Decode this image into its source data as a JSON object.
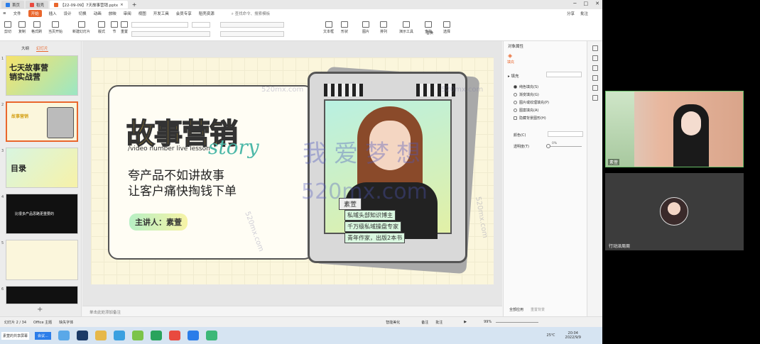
{
  "tabs": [
    {
      "label": "首页",
      "color": "#2b7de9"
    },
    {
      "label": "稻壳",
      "color": "#e94a3f"
    },
    {
      "label": "【22-09-09】7天故事营销.pptx",
      "color": "#e9662c"
    }
  ],
  "menu": {
    "file": "文件",
    "items": [
      "开始",
      "插入",
      "设计",
      "切换",
      "动画",
      "放映",
      "审阅",
      "视图",
      "开发工具",
      "会员专享",
      "稻壳资源"
    ],
    "search": "查找命令、搜索模板",
    "right": [
      "分享",
      "批注"
    ]
  },
  "ribbon": {
    "buttons": [
      "剪切",
      "复制",
      "格式刷",
      "当页开始",
      "新建幻灯片",
      "版式",
      "节",
      "重置",
      "文本框",
      "形状",
      "图片",
      "排列",
      "演示工具",
      "查找",
      "替换",
      "选择"
    ]
  },
  "thumbs": {
    "tabs": [
      "大纲",
      "幻灯片"
    ],
    "slides": [
      {
        "num": "1",
        "title": "七天故事营销实战营"
      },
      {
        "num": "2",
        "title": "故事营销"
      },
      {
        "num": "3",
        "title": "目录"
      },
      {
        "num": "4",
        "title": "比很多产品思路更重要的"
      },
      {
        "num": "5",
        "title": ""
      },
      {
        "num": "6",
        "title": ""
      }
    ],
    "add": "+"
  },
  "slide": {
    "hero": "故事营销",
    "story": "story",
    "sub": "/video number live lesson",
    "line1": "夸产品不如讲故事",
    "line2": "让客户痛快掏钱下单",
    "speaker": "主讲人：素萱",
    "name_tag": "素萱",
    "tags": [
      "私域头部知识博主",
      "千万级私域操盘专家",
      "青年作家，出版2本书"
    ]
  },
  "watermark": {
    "main": "我爱梦想",
    "domain": "520mx.com",
    "small": "520mx.com"
  },
  "notes": "单击此处添加备注",
  "status": {
    "slide": "幻灯片 2 / 34",
    "theme": "Office 主题",
    "font": "缺失字体",
    "beautify": "智能美化",
    "notes_btn": "备注",
    "comment_btn": "批注",
    "zoom": "99%"
  },
  "props": {
    "title": "对象属性",
    "tab": "填充",
    "section": "▸ 填充",
    "options": [
      "纯色填充(S)",
      "渐变填充(G)",
      "图片或纹理填充(P)",
      "图案填充(A)",
      "隐藏背景图形(H)"
    ],
    "selected_index": 0,
    "color_label": "颜色(C)",
    "transparency_label": "透明度(T)",
    "transparency_value": "0%",
    "apply_all": "全部应用",
    "reset": "重置背景"
  },
  "taskbar": {
    "items": [
      "素萱的共享屏幕",
      "会议..."
    ],
    "clock": "20:04",
    "date": "2022/9/9",
    "temp": "25℃"
  },
  "video": {
    "speaker_label": "素萱",
    "viewer_label": "行动派周周"
  }
}
